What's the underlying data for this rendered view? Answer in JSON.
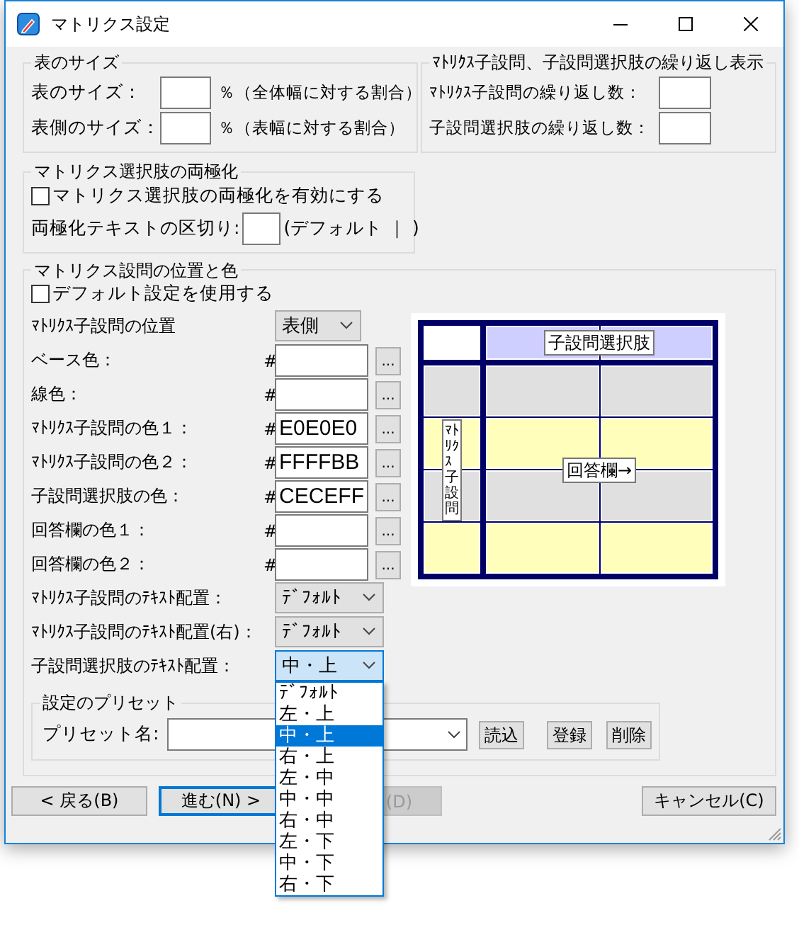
{
  "window": {
    "title": "マトリクス設定"
  },
  "table_size": {
    "title": "表のサイズ",
    "rows": [
      {
        "label": "表のサイズ：",
        "note": "％（全体幅に対する割合）"
      },
      {
        "label": "表側のサイズ：",
        "note": "％（表幅に対する割合）"
      }
    ]
  },
  "repeat_display": {
    "title": "ﾏﾄﾘｸｽ子設問、子設問選択肢の繰り返し表示",
    "rows": [
      {
        "label": "ﾏﾄﾘｸｽ子設問の繰り返し数："
      },
      {
        "label": "子設問選択肢の繰り返し数："
      }
    ]
  },
  "polarize": {
    "title": "マトリクス選択肢の両極化",
    "checkbox": {
      "label": "マトリクス選択肢の両極化を有効にする",
      "checked": false
    },
    "separator": {
      "label": "両極化テキストの区切り:",
      "note": "(デフォルト ｜ )"
    }
  },
  "position_color": {
    "title": "マトリクス設問の位置と色",
    "checkbox": {
      "label": "デフォルト設定を使用する",
      "checked": false
    },
    "rows": [
      {
        "kind": "select",
        "label": "ﾏﾄﾘｸｽ子設問の位置",
        "value": "表側",
        "open": false
      },
      {
        "kind": "color",
        "label": "ベース色：",
        "hash": "#",
        "browse": "..."
      },
      {
        "kind": "color",
        "label": "線色：",
        "hash": "#",
        "browse": "..."
      },
      {
        "kind": "color",
        "label": "ﾏﾄﾘｸｽ子設問の色１：",
        "hash": "#",
        "value": "E0E0E0",
        "browse": "..."
      },
      {
        "kind": "color",
        "label": "ﾏﾄﾘｸｽ子設問の色２：",
        "hash": "#",
        "value": "FFFFBB",
        "browse": "..."
      },
      {
        "kind": "color",
        "label": "子設問選択肢の色：",
        "hash": "#",
        "value": "CECEFF",
        "browse": "..."
      },
      {
        "kind": "color",
        "label": "回答欄の色１：",
        "hash": "#",
        "browse": "..."
      },
      {
        "kind": "color",
        "label": "回答欄の色２：",
        "hash": "#",
        "browse": "..."
      },
      {
        "kind": "select",
        "label": "ﾏﾄﾘｸｽ子設問のﾃｷｽﾄ配置：",
        "value": "ﾃﾞﾌｫﾙﾄ",
        "open": false
      },
      {
        "kind": "select",
        "label": "ﾏﾄﾘｸｽ子設問のﾃｷｽﾄ配置(右)：",
        "value": "ﾃﾞﾌｫﾙﾄ",
        "open": false
      },
      {
        "kind": "select",
        "label": "子設問選択肢のﾃｷｽﾄ配置：",
        "value": "中・上",
        "open": true,
        "options": [
          {
            "label": "ﾃﾞﾌｫﾙﾄ",
            "selected": false
          },
          {
            "label": "左・上",
            "selected": false
          },
          {
            "label": "中・上",
            "selected": true
          },
          {
            "label": "右・上",
            "selected": false
          },
          {
            "label": "左・中",
            "selected": false
          },
          {
            "label": "中・中",
            "selected": false
          },
          {
            "label": "右・中",
            "selected": false
          },
          {
            "label": "左・下",
            "selected": false
          },
          {
            "label": "中・下",
            "selected": false
          },
          {
            "label": "右・下",
            "selected": false
          }
        ]
      }
    ],
    "preview": {
      "header": "子設問選択肢",
      "side": "ﾏﾄﾘｸｽ子設問",
      "answer": "回答欄→"
    },
    "preset": {
      "title": "設定のプリセット",
      "label": "プリセット名:",
      "buttons": [
        "読込",
        "登録",
        "削除"
      ]
    }
  },
  "buttons": [
    {
      "label": "< 戻る(B)",
      "focused": false,
      "disabled": false
    },
    {
      "label": "進む(N) >",
      "focused": true,
      "disabled": false
    },
    {
      "label": "(D)",
      "focused": false,
      "disabled": true
    },
    {
      "label": "キャンセル(C)",
      "focused": false,
      "disabled": false
    }
  ]
}
